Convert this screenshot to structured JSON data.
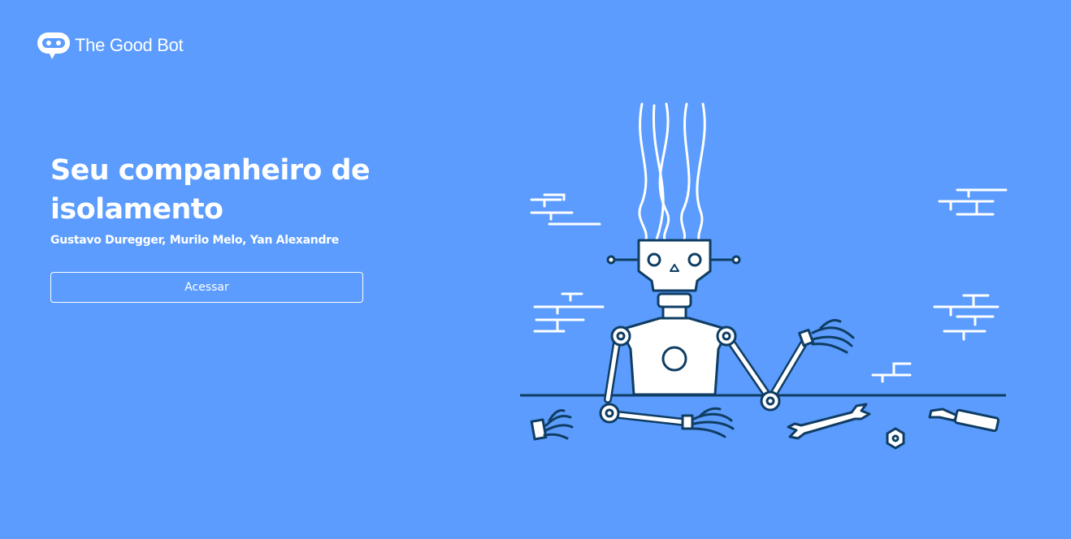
{
  "brand": {
    "name": "The Good Bot",
    "logo_icon": "chat-robot-icon"
  },
  "hero": {
    "title": "Seu companheiro de isolamento",
    "authors": "Gustavo Duregger, Murilo Melo, Yan Alexandre"
  },
  "actions": {
    "access_label": "Acessar"
  },
  "colors": {
    "background": "#5b9cfe",
    "foreground": "#ffffff",
    "illustration_outline": "#0f3d63"
  },
  "illustration": {
    "icon": "broken-robot-illustration"
  }
}
